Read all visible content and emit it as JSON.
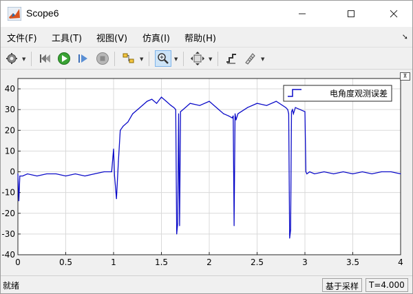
{
  "window": {
    "title": "Scope6"
  },
  "menu": [
    {
      "label": "文件(F)"
    },
    {
      "label": "工具(T)"
    },
    {
      "label": "视图(V)"
    },
    {
      "label": "仿真(I)"
    },
    {
      "label": "帮助(H)"
    }
  ],
  "toolbar": {
    "icons": [
      "gear-icon",
      "print-icon",
      "run-icon",
      "step-forward-icon",
      "stop-icon",
      "highlight-block-icon",
      "zoom-in-icon",
      "fit-to-view-icon",
      "style-icon",
      "measure-icon"
    ]
  },
  "status": {
    "left": "就绪",
    "sample_mode": "基于采样",
    "time": "T=4.000"
  },
  "colors": {
    "plot_background": "#ffffff",
    "signal": "#0a0ac8",
    "grid": "#d9d9d9"
  },
  "chart_data": {
    "type": "line",
    "title": "",
    "xlabel": "",
    "ylabel": "",
    "xlim": [
      0,
      4
    ],
    "ylim": [
      -40,
      45
    ],
    "xticks": [
      "0",
      "0.5",
      "1",
      "1.5",
      "2",
      "2.5",
      "3",
      "3.5",
      "4"
    ],
    "yticks": [
      "40",
      "30",
      "20",
      "10",
      "0",
      "-10",
      "-20",
      "-30",
      "-40"
    ],
    "grid": true,
    "legend": "top-right",
    "series": [
      {
        "name": "电角度观测误差",
        "x": [
          0,
          0.01,
          0.02,
          0.05,
          0.1,
          0.2,
          0.3,
          0.4,
          0.5,
          0.6,
          0.7,
          0.8,
          0.9,
          0.98,
          1.0,
          1.01,
          1.03,
          1.05,
          1.07,
          1.1,
          1.15,
          1.2,
          1.25,
          1.3,
          1.35,
          1.4,
          1.45,
          1.5,
          1.55,
          1.6,
          1.63,
          1.65,
          1.66,
          1.67,
          1.68,
          1.69,
          1.7,
          1.75,
          1.8,
          1.9,
          2.0,
          2.1,
          2.15,
          2.2,
          2.24,
          2.25,
          2.26,
          2.27,
          2.28,
          2.3,
          2.4,
          2.5,
          2.6,
          2.7,
          2.8,
          2.82,
          2.83,
          2.84,
          2.85,
          2.86,
          2.87,
          2.88,
          2.9,
          2.95,
          3.0,
          3.01,
          3.02,
          3.05,
          3.1,
          3.2,
          3.3,
          3.4,
          3.5,
          3.6,
          3.7,
          3.8,
          3.9,
          4.0
        ],
        "y": [
          -1,
          -14,
          -2,
          -2,
          -1,
          -2,
          -1,
          -1,
          -2,
          -1,
          -2,
          -1,
          0,
          0,
          11,
          -2,
          -13,
          5,
          20,
          22,
          24,
          28,
          30,
          32,
          34,
          35,
          33,
          36,
          34,
          32,
          31,
          30,
          -30,
          -25,
          28,
          -26,
          29,
          31,
          33,
          32,
          34,
          30,
          28,
          27,
          26,
          27,
          -26,
          28,
          25,
          28,
          31,
          33,
          32,
          34,
          31,
          30,
          28,
          -32,
          -28,
          29,
          30,
          28,
          31,
          30,
          29,
          0,
          -1,
          0,
          -1,
          0,
          -1,
          0,
          -1,
          0,
          -1,
          0,
          0,
          -1
        ]
      }
    ]
  }
}
